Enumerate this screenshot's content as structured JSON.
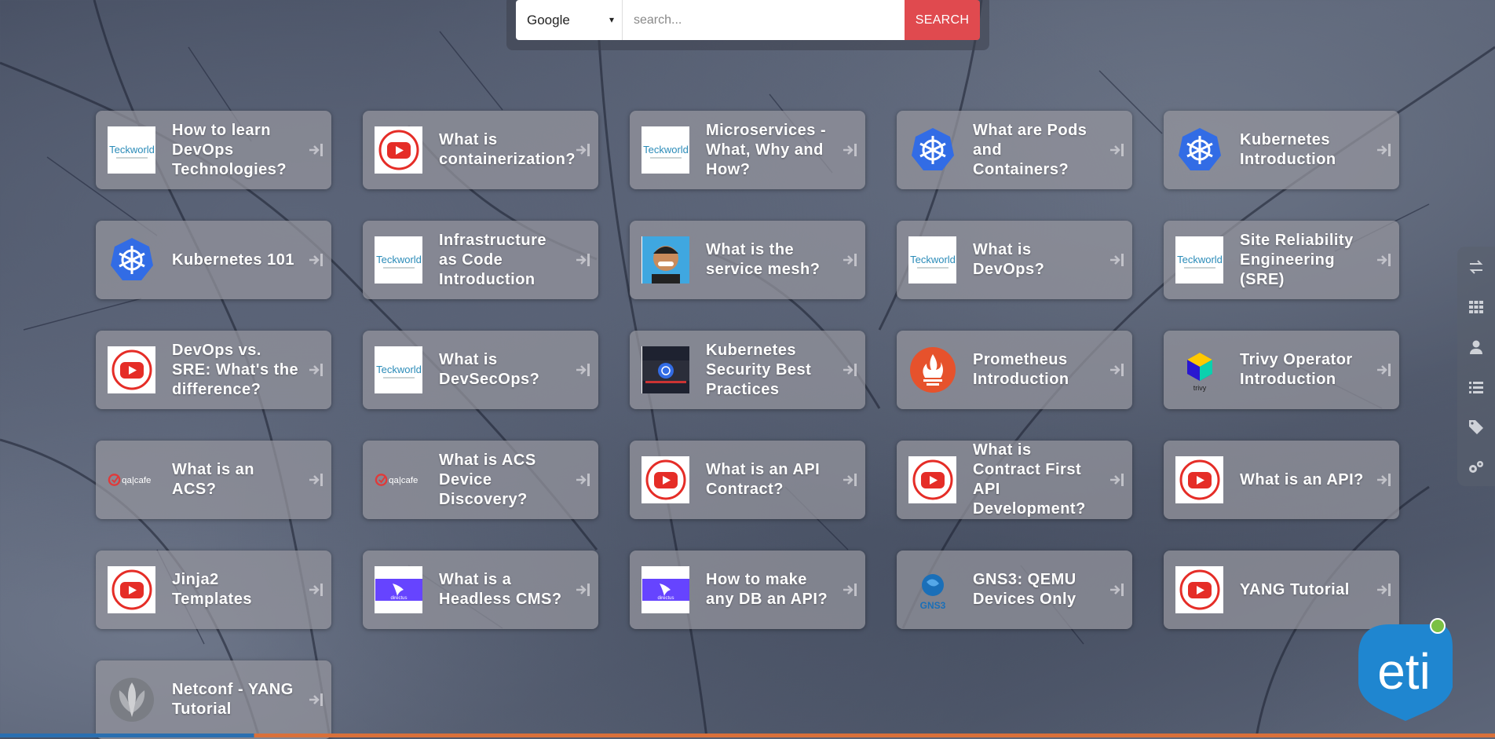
{
  "search": {
    "engine": "Google",
    "placeholder": "search...",
    "button_label": "SEARCH"
  },
  "tiles": [
    {
      "label": "How to learn DevOps Technologies?",
      "icon": "teckworld-logo-icon"
    },
    {
      "label": "What is containerization?",
      "icon": "youtube-icon"
    },
    {
      "label": "Microservices - What, Why and How?",
      "icon": "teckworld-logo-icon"
    },
    {
      "label": "What are Pods and Containers?",
      "icon": "kubernetes-icon"
    },
    {
      "label": "Kubernetes Introduction",
      "icon": "kubernetes-icon"
    },
    {
      "label": "Kubernetes 101",
      "icon": "kubernetes-icon"
    },
    {
      "label": "Infrastructure as Code Introduction",
      "icon": "teckworld-logo-icon"
    },
    {
      "label": "What is the service mesh?",
      "icon": "avatar-icon"
    },
    {
      "label": "What is DevOps?",
      "icon": "teckworld-logo-icon"
    },
    {
      "label": "Site Reliability Engineering (SRE)",
      "icon": "teckworld-logo-icon"
    },
    {
      "label": "DevOps vs. SRE: What's the difference?",
      "icon": "youtube-icon"
    },
    {
      "label": "What is DevSecOps?",
      "icon": "teckworld-logo-icon"
    },
    {
      "label": "Kubernetes Security Best Practices",
      "icon": "kubernetes-security-icon"
    },
    {
      "label": "Prometheus Introduction",
      "icon": "prometheus-icon"
    },
    {
      "label": "Trivy Operator Introduction",
      "icon": "trivy-icon"
    },
    {
      "label": "What is an ACS?",
      "icon": "qacafe-logo-icon"
    },
    {
      "label": "What is ACS Device Discovery?",
      "icon": "qacafe-logo-icon"
    },
    {
      "label": "What is an API Contract?",
      "icon": "youtube-icon"
    },
    {
      "label": "What is Contract First API Development?",
      "icon": "youtube-icon"
    },
    {
      "label": "What is an API?",
      "icon": "youtube-icon"
    },
    {
      "label": "Jinja2 Templates",
      "icon": "youtube-icon"
    },
    {
      "label": "What is a Headless CMS?",
      "icon": "directus-icon"
    },
    {
      "label": "How to make any DB an API?",
      "icon": "directus-icon"
    },
    {
      "label": "GNS3: QEMU Devices Only",
      "icon": "gns3-icon"
    },
    {
      "label": "YANG Tutorial",
      "icon": "youtube-icon"
    },
    {
      "label": "Netconf - YANG Tutorial",
      "icon": "netconf-icon"
    }
  ],
  "thumb_text": {
    "teckworld": "Teckworld",
    "qacafe": "qa|cafe",
    "trivy": "trivy",
    "gns3": "GNS3",
    "directus": "directus"
  },
  "sidebar_icons": [
    "swap-icon",
    "grid-icon",
    "user-icon",
    "list-icon",
    "tag-icon",
    "settings-icon"
  ],
  "logo_text": "eti",
  "colors": {
    "search_button": "#e04a4f",
    "youtube_red": "#e52d27",
    "kubernetes_blue": "#326ce5",
    "prometheus_orange": "#e6522c",
    "logo_blue": "#1f86d0",
    "logo_green": "#7bc043"
  }
}
